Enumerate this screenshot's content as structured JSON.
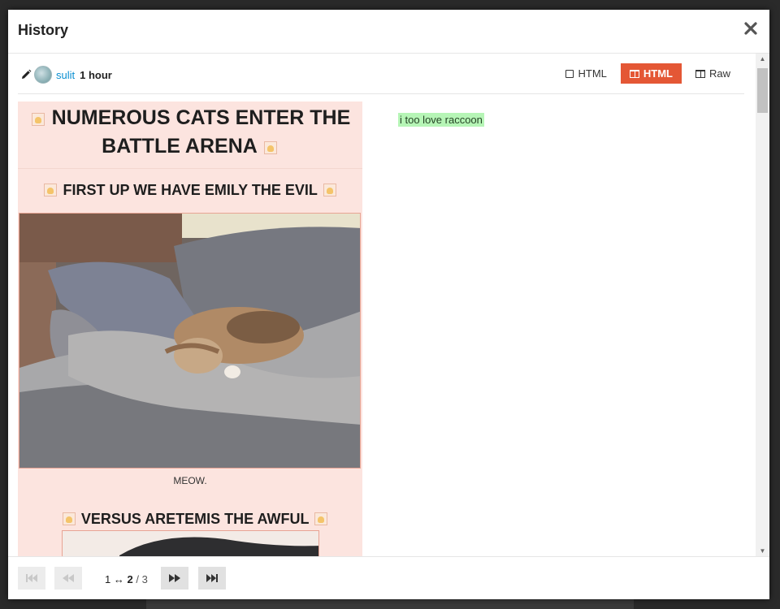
{
  "modal": {
    "title": "History",
    "close_icon": "close-icon"
  },
  "revision": {
    "user": "sulit",
    "time": "1 hour"
  },
  "view_modes": [
    {
      "label": "HTML",
      "icon": "square-icon",
      "active": false
    },
    {
      "label": "HTML",
      "icon": "columns-icon",
      "active": true
    },
    {
      "label": "Raw",
      "icon": "columns-icon",
      "active": false
    }
  ],
  "diff": {
    "left": {
      "heading1": "NUMEROUS CATS ENTER THE BATTLE ARENA",
      "heading2": "FIRST UP WE HAVE EMILY THE EVIL",
      "caption": "MEOW.",
      "heading3": "VERSUS ARETEMIS THE AWFUL"
    },
    "right": {
      "inserted_text": "i too love raccoon"
    }
  },
  "pager": {
    "from": "1",
    "arrow": "↔",
    "to": "2",
    "separator": "/",
    "total": "3"
  },
  "colors": {
    "accent": "#e45735",
    "deleted_bg": "#fce4df",
    "inserted_bg": "#b6f5b6",
    "link": "#0a8fd1"
  }
}
